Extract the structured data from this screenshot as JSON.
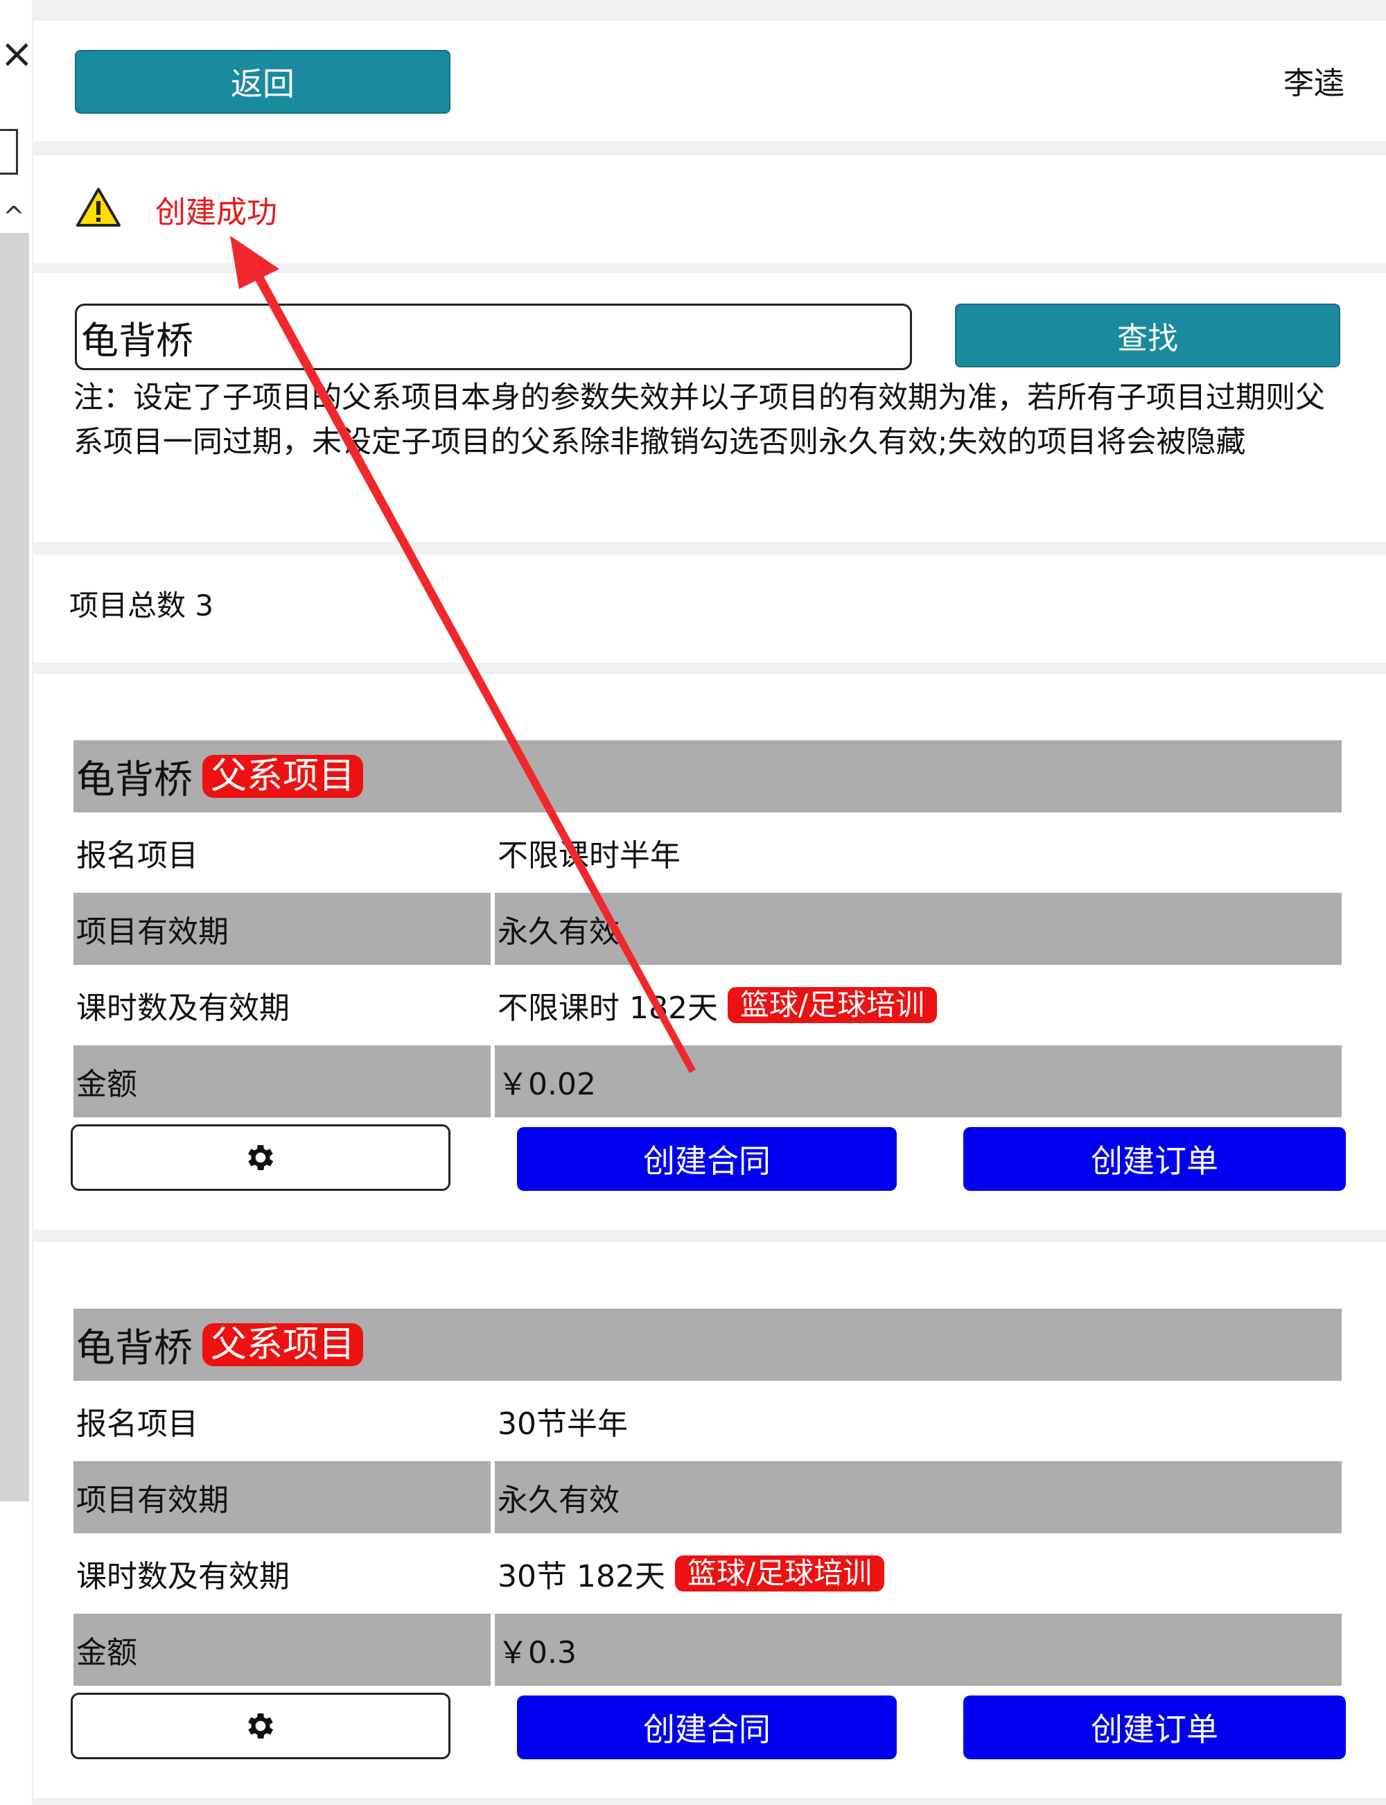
{
  "header": {
    "back_label": "返回",
    "username": "李逵"
  },
  "alert": {
    "message": "创建成功"
  },
  "search": {
    "value": "龟背桥",
    "button_label": "查找"
  },
  "note": "注：设定了子项目的父系项目本身的参数失效并以子项目的有效期为准，若所有子项目过期则父系项目一同过期，未设定子项目的父系除非撤销勾选否则永久有效;失效的项目将会被隐藏",
  "summary": {
    "project_count_label": "项目总数 3"
  },
  "cards": [
    {
      "title": "龟背桥",
      "badge": "父系项目",
      "rows": [
        {
          "label": "报名项目",
          "value": "不限课时半年"
        },
        {
          "label": "项目有效期",
          "value": "永久有效"
        },
        {
          "label": "课时数及有效期",
          "value": "不限课时 182天",
          "tag": "篮球/足球培训"
        },
        {
          "label": "金额",
          "value": "￥0.02"
        }
      ],
      "actions": {
        "contract_label": "创建合同",
        "order_label": "创建订单"
      }
    },
    {
      "title": "龟背桥",
      "badge": "父系项目",
      "rows": [
        {
          "label": "报名项目",
          "value": "30节半年"
        },
        {
          "label": "项目有效期",
          "value": "永久有效"
        },
        {
          "label": "课时数及有效期",
          "value": "30节 182天",
          "tag": "篮球/足球培训"
        },
        {
          "label": "金额",
          "value": "￥0.3"
        }
      ],
      "actions": {
        "contract_label": "创建合同",
        "order_label": "创建订单"
      }
    }
  ],
  "colors": {
    "teal_button": "#1a8a9e",
    "blue_button": "#0000f0",
    "badge_red": "#ee1111",
    "alert_red": "#e81818",
    "row_gray": "#adadad",
    "annotation_arrow": "#f0282d"
  },
  "icons": {
    "alert": "warning-triangle-icon",
    "settings": "gear-icon"
  }
}
